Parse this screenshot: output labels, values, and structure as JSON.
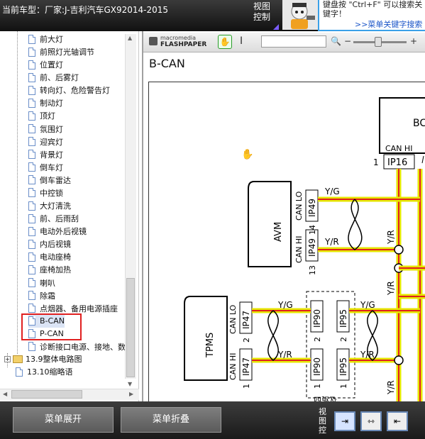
{
  "header": {
    "title": "当前车型：厂家:J-吉利汽车GX92014-2015",
    "view_control": "视图控制",
    "tip_text": "键盘按 \"Ctrl+F\" 可以搜索关键字！",
    "tip_link": ">>菜单关键字搜索"
  },
  "tree": {
    "items": [
      {
        "label": "前大灯",
        "top": 0
      },
      {
        "label": "前照灯光轴调节"
      },
      {
        "label": "位置灯"
      },
      {
        "label": "前、后雾灯"
      },
      {
        "label": "转向灯、危险警告灯"
      },
      {
        "label": "制动灯"
      },
      {
        "label": "顶灯"
      },
      {
        "label": "氛围灯"
      },
      {
        "label": "迎宾灯"
      },
      {
        "label": "背景灯"
      },
      {
        "label": "倒车灯"
      },
      {
        "label": "倒车雷达"
      },
      {
        "label": "中控锁"
      },
      {
        "label": "大灯清洗"
      },
      {
        "label": "前、后雨刮"
      },
      {
        "label": "电动外后视镜"
      },
      {
        "label": "内后视镜"
      },
      {
        "label": "电动座椅"
      },
      {
        "label": "座椅加热"
      },
      {
        "label": "喇叭"
      },
      {
        "label": "除霜"
      },
      {
        "label": "点烟器、备用电源插座"
      },
      {
        "label": "B-CAN"
      },
      {
        "label": "P-CAN"
      },
      {
        "label": "诊断接口电源、接地、数"
      }
    ],
    "folder_item": "13.9整体电路图",
    "last_item": "13.10缩略语"
  },
  "viewer": {
    "logo_line1": "macromedia",
    "logo_line2": "FLASHPAPER",
    "page_title": "B-CAN"
  },
  "diagram": {
    "bcm_label": "BC",
    "can_hi": "CAN HI",
    "can_lo": "CAN LO",
    "pin1": "1",
    "pin13": "13",
    "pin14": "14",
    "pin2": "2",
    "ip16": "IP16",
    "ip49": "IP49",
    "ip47": "IP47",
    "ip90": "IP90",
    "ip95": "IP95",
    "avm": "AVM",
    "tpms": "TPMS",
    "yg": "Y/G",
    "yr": "Y/R",
    "four_wd": "四驱及"
  },
  "footer": {
    "expand": "菜单展开",
    "collapse": "菜单折叠",
    "view_label": "视图控"
  }
}
